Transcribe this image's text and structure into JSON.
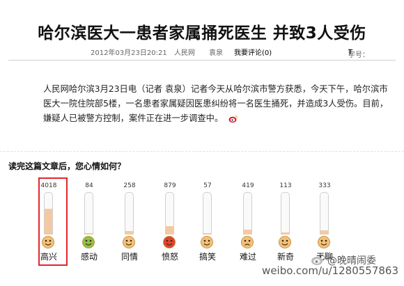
{
  "article": {
    "title": "哈尔滨医大一患者家属捅死医生  并致3人受伤",
    "date": "2012年03月23日20:21",
    "source": "人民网",
    "author": "袁泉",
    "comments": "我要评论(0)",
    "font_size_label": "字号：",
    "font_size_large": "T",
    "font_size_small": "T",
    "body": "人民网哈尔滨3月23日电（记者 袁泉）记者今天从哈尔滨市警方获悉，今天下午，哈尔滨市医大一院住院部5楼，一名患者家属疑因医患纠纷将一名医生捅死，并造成3人受伤。目前，嫌疑人已被警方控制，案件正在进一步调查中。"
  },
  "poll": {
    "question": "读完这篇文章后，您心情如何？",
    "moods": [
      {
        "label": "高兴",
        "count": "4018",
        "fill_pct": 62,
        "icon": "happy-face-icon",
        "color": "#f3c07a"
      },
      {
        "label": "感动",
        "count": "84",
        "fill_pct": 4,
        "icon": "moved-face-icon",
        "color": "#8fc14a"
      },
      {
        "label": "同情",
        "count": "258",
        "fill_pct": 8,
        "icon": "sympathy-face-icon",
        "color": "#f3c07a"
      },
      {
        "label": "愤怒",
        "count": "879",
        "fill_pct": 20,
        "icon": "angry-face-icon",
        "color": "#e0452f"
      },
      {
        "label": "搞笑",
        "count": "57",
        "fill_pct": 4,
        "icon": "funny-face-icon",
        "color": "#f3c07a"
      },
      {
        "label": "难过",
        "count": "419",
        "fill_pct": 12,
        "icon": "sad-face-icon",
        "color": "#f3c07a"
      },
      {
        "label": "新奇",
        "count": "113",
        "fill_pct": 5,
        "icon": "curious-face-icon",
        "color": "#f3c07a"
      },
      {
        "label": "无聊",
        "count": "333",
        "fill_pct": 10,
        "icon": "bored-face-icon",
        "color": "#f3c07a"
      }
    ]
  },
  "watermark": {
    "url": "weibo.com/u/1280557863",
    "name": "@晚晴闹委"
  }
}
